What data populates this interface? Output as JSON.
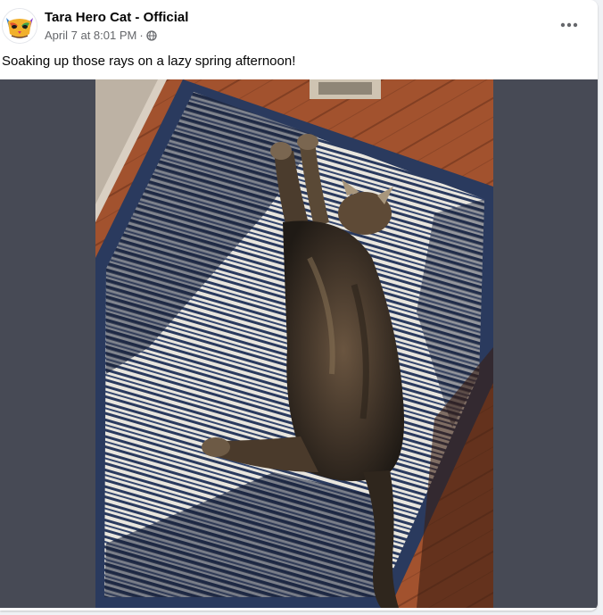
{
  "post": {
    "author": "Tara Hero Cat - Official",
    "timestamp": "April 7 at 8:01 PM",
    "separator": "·",
    "audience_icon": "globe-icon",
    "more_icon": "more-options-icon",
    "caption": "Soaking up those rays on a lazy spring afternoon!",
    "photo_subject": "cat-stretched-on-striped-rug"
  },
  "colors": {
    "name": "#050505",
    "meta": "#65676b",
    "media_backdrop": "#474a55",
    "rug_navy": "#2a3a5e",
    "rug_cream": "#e9e6de",
    "floor_wood": "#b05a32"
  }
}
